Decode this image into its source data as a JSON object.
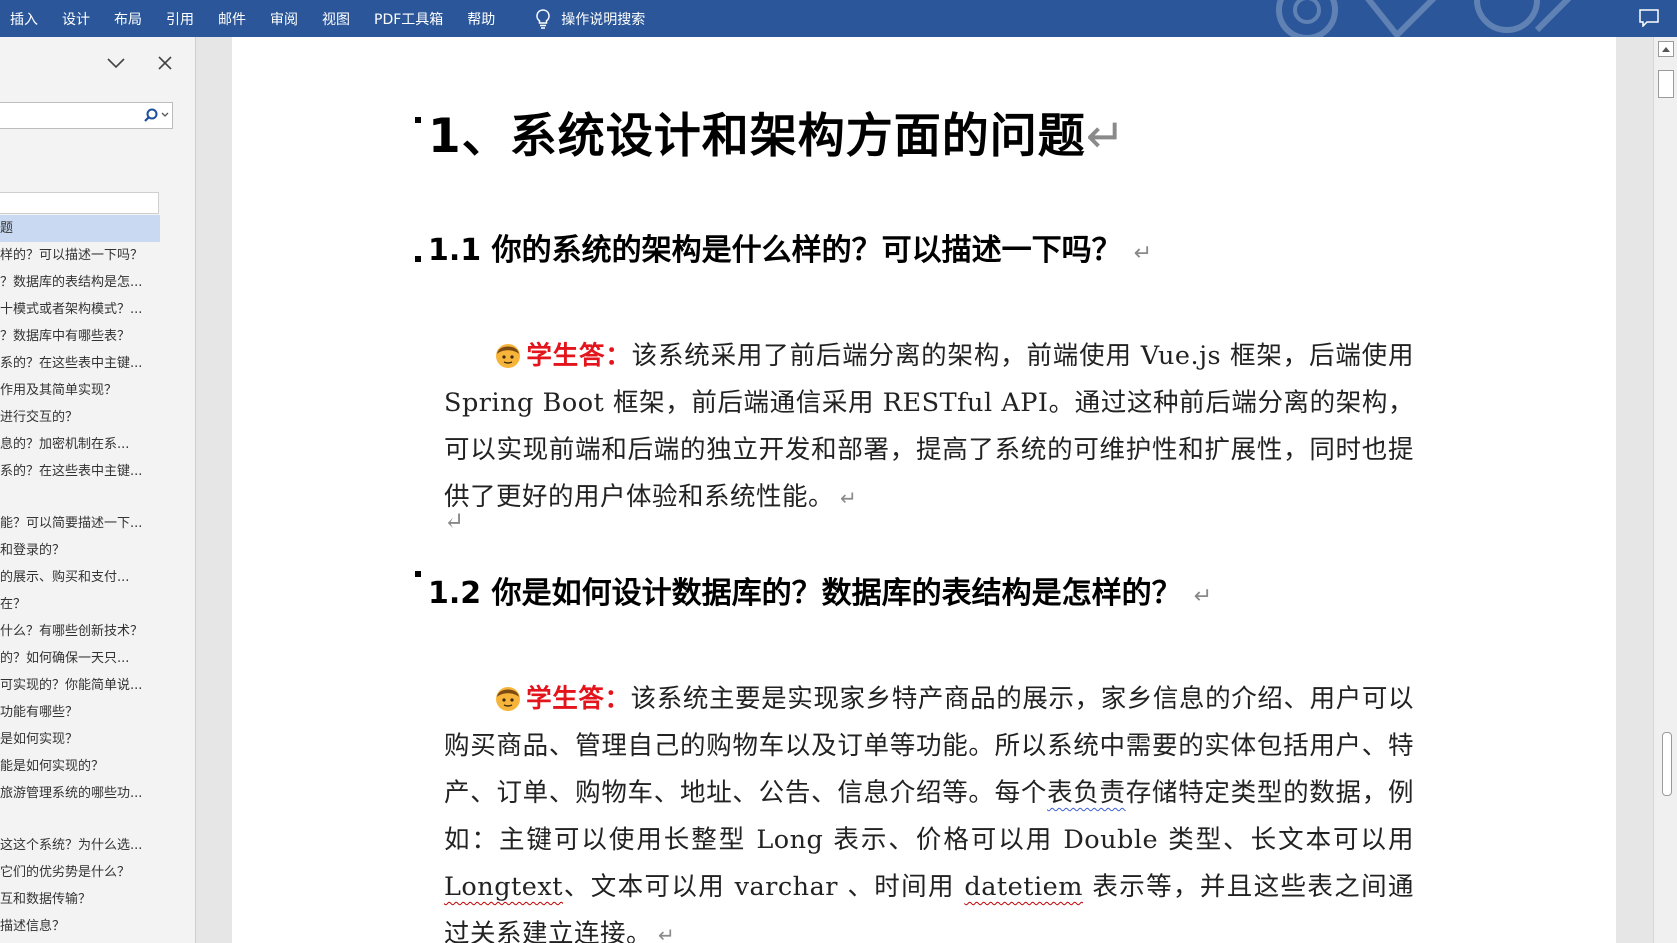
{
  "ribbon": {
    "tabs": [
      "插入",
      "设计",
      "布局",
      "引用",
      "邮件",
      "审阅",
      "视图",
      "PDF工具箱",
      "帮助"
    ],
    "tell_me": "操作说明搜索",
    "bg": "#2b579a"
  },
  "nav": {
    "items": [
      "题",
      "样的？可以描述一下吗？",
      "？数据库的表结构是怎...",
      "十模式或者架构模式？...",
      "？数据库中有哪些表？",
      "系的？在这些表中主键...",
      "作用及其简单实现？",
      "进行交互的？",
      "息的？加密机制在系...",
      "系的？在这些表中主键...",
      "能？可以简要描述一下...",
      "和登录的？",
      "的展示、购买和支付...",
      "在？",
      "什么？有哪些创新技术？",
      "的？如何确保一天只...",
      "可实现的？你能简单说...",
      "功能有哪些？",
      "是如何实现？",
      "能是如何实现的？",
      "旅游管理系统的哪些功...",
      "这这个系统？为什么选...",
      "它们的优劣势是什么？",
      "互和数据传输？",
      "描述信息？"
    ]
  },
  "document": {
    "h1": "1、系统设计和架构方面的问题",
    "sections": [
      {
        "heading": "1.1 你的系统的架构是什么样的？可以描述一下吗？",
        "label": "学生答：",
        "text": "该系统采用了前后端分离的架构，前端使用 Vue.js 框架，后端使用 Spring Boot 框架，前后端通信采用 RESTful API。通过这种前后端分离的架构，可以实现前端和后端的独立开发和部署，提高了系统的可维护性和扩展性，同时也提供了更好的用户体验和系统性能。"
      },
      {
        "heading": "1.2 你是如何设计数据库的？数据库的表结构是怎样的？",
        "label": "学生答：",
        "text_a": "该系统主要是实现家乡特产商品的展示，家乡信息的介绍、用户可以购买商品、管理自己的购物车以及订单等功能。所以系统中需要的实体包括用户、特产、订单、购物车、地址、公告、信息介绍等。每个",
        "text_squig_blue": "表负责",
        "text_b": "存储特定类型的数据，例如：主键可以使用长整型 Long 表示、价格可以用 Double 类型、长文本可以用 ",
        "squig_1": "Longtext",
        "text_c": "、文本可以用 varchar 、时间用 ",
        "squig_2": "datetiem",
        "text_d": " 表示等，并且这些表之间通过",
        "squig_3": "关系建立",
        "text_e": "连接。"
      }
    ],
    "paragraph_mark": "↵"
  }
}
